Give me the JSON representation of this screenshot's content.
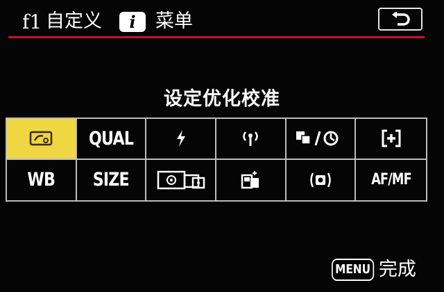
{
  "header": {
    "id": "f1",
    "title": "自定义",
    "info_badge": "i",
    "menu_label": "菜单",
    "back_icon": "return-arrow-icon"
  },
  "section": {
    "title": "设定优化校准"
  },
  "grid": {
    "selected": "picture-mode",
    "cells": [
      {
        "label": "",
        "icon": "picture-mode-icon"
      },
      {
        "label": "QUAL"
      },
      {
        "label": "",
        "icon": "flash-icon"
      },
      {
        "label": "",
        "icon": "wireless-icon"
      },
      {
        "label": "",
        "icon": "drive-self-timer-icon"
      },
      {
        "label": "",
        "icon": "af-area-icon"
      },
      {
        "label": "WB"
      },
      {
        "label": "SIZE"
      },
      {
        "label": "",
        "icon": "metering-icon"
      },
      {
        "label": "",
        "icon": "card-info-icon"
      },
      {
        "label": "",
        "icon": "vibration-reduction-icon"
      },
      {
        "label": "AF/MF"
      }
    ]
  },
  "footer": {
    "menu_badge": "MENU",
    "done_label": "完成"
  },
  "colors": {
    "accent_red": "#c8102e",
    "selected_yellow": "#f0d640",
    "grid_line": "#bdbdbd"
  }
}
